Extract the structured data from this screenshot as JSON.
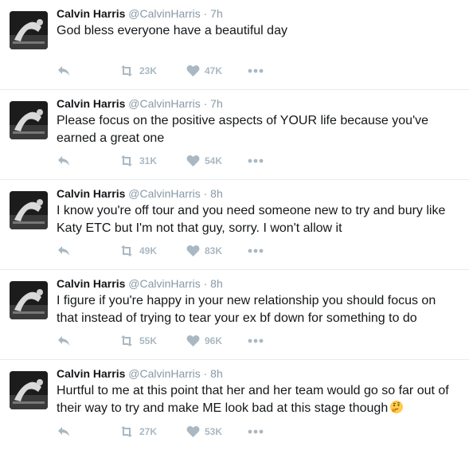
{
  "colors": {
    "name": "#14171a",
    "meta": "#8899a6",
    "action": "#aab8c2",
    "divider": "#e6ecf0"
  },
  "tweets": [
    {
      "name": "Calvin Harris",
      "handle": "@CalvinHarris",
      "sep": "·",
      "time": "7h",
      "text": "God bless everyone have a beautiful day",
      "retweets": "23K",
      "likes": "47K",
      "emoji": ""
    },
    {
      "name": "Calvin Harris",
      "handle": "@CalvinHarris",
      "sep": "·",
      "time": "7h",
      "text": "Please focus on the positive aspects of YOUR life because you've earned a great one",
      "retweets": "31K",
      "likes": "54K",
      "emoji": ""
    },
    {
      "name": "Calvin Harris",
      "handle": "@CalvinHarris",
      "sep": "·",
      "time": "8h",
      "text": "I know you're off tour and you need someone new to try and bury like Katy ETC but I'm not that guy, sorry. I won't allow it",
      "retweets": "49K",
      "likes": "83K",
      "emoji": ""
    },
    {
      "name": "Calvin Harris",
      "handle": "@CalvinHarris",
      "sep": "·",
      "time": "8h",
      "text": "I figure if you're happy in your new relationship you should focus on that instead of trying to tear your ex bf down for something to do",
      "retweets": "55K",
      "likes": "96K",
      "emoji": ""
    },
    {
      "name": "Calvin Harris",
      "handle": "@CalvinHarris",
      "sep": "·",
      "time": "8h",
      "text": "Hurtful to me at this point that her and her team would go so far out of their way to try and make ME look bad at this stage though",
      "retweets": "27K",
      "likes": "53K",
      "emoji": "thinking-face-emoji"
    }
  ],
  "icons": {
    "reply": "reply-icon",
    "retweet": "retweet-icon",
    "like": "heart-icon",
    "more": "more-dots-icon"
  }
}
